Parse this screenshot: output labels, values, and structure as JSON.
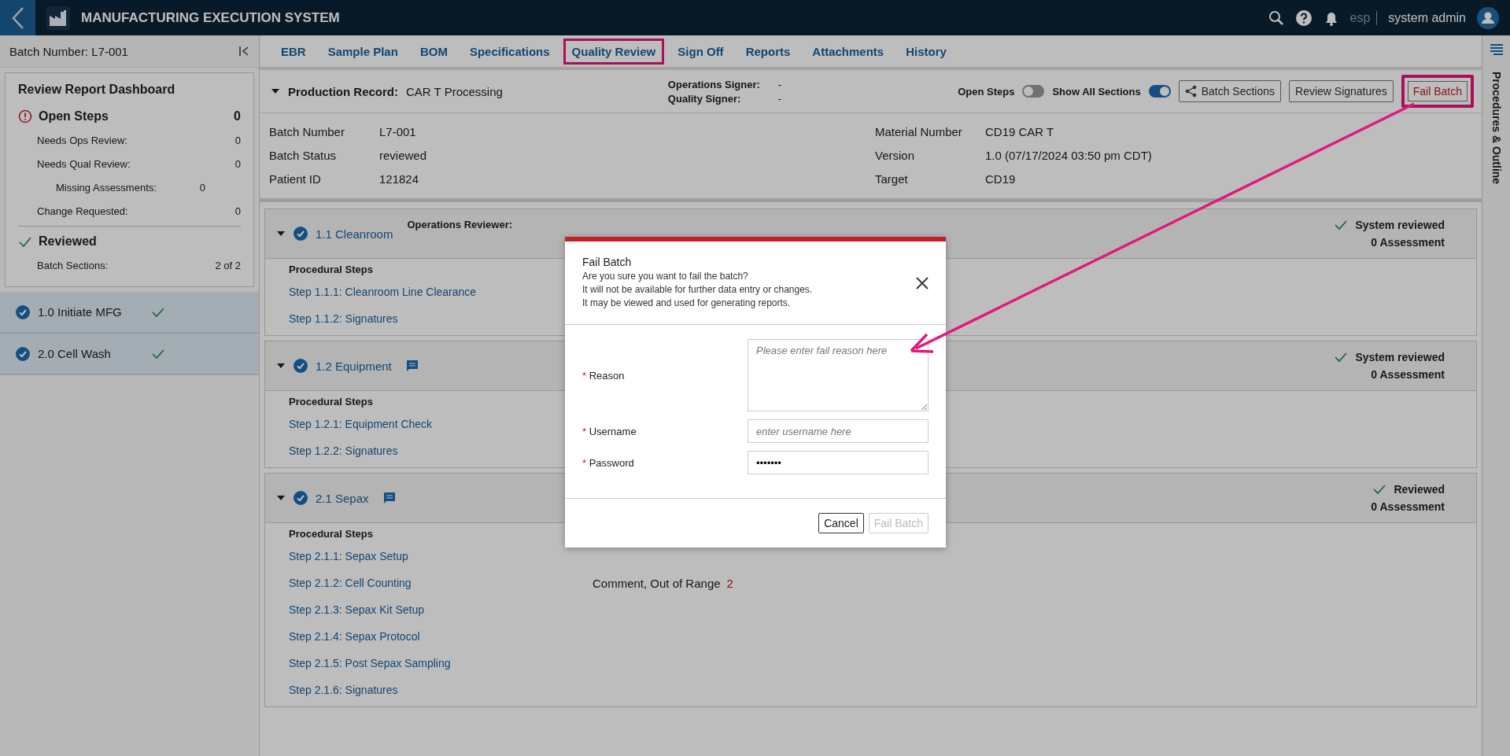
{
  "app_bar": {
    "title": "MANUFACTURING EXECUTION SYSTEM",
    "language": "esp",
    "user": "system admin"
  },
  "sidebar": {
    "batch_title": "Batch Number: L7-001",
    "dashboard": {
      "title": "Review Report Dashboard",
      "open_label": "Open Steps",
      "open_count": "0",
      "open_rows": [
        {
          "label": "Needs Ops Review:",
          "value": "0"
        },
        {
          "label": "Needs Qual Review:",
          "value": "0",
          "children": [
            {
              "label": "Missing Assessments:",
              "value": "0"
            }
          ]
        },
        {
          "label": "Change Requested:",
          "value": "0"
        }
      ],
      "reviewed_label": "Reviewed",
      "reviewed_rows": [
        {
          "label": "Batch Sections:",
          "value": "2 of 2"
        }
      ]
    },
    "sections": [
      {
        "label": "1.0 Initiate MFG",
        "done": true
      },
      {
        "label": "2.0 Cell Wash",
        "done": true
      }
    ]
  },
  "tabs": [
    {
      "label": "EBR",
      "highlighted": false
    },
    {
      "label": "Sample Plan",
      "highlighted": false
    },
    {
      "label": "BOM",
      "highlighted": false
    },
    {
      "label": "Specifications",
      "highlighted": false
    },
    {
      "label": "Quality Review",
      "highlighted": true
    },
    {
      "label": "Sign Off",
      "highlighted": false
    },
    {
      "label": "Reports",
      "highlighted": false
    },
    {
      "label": "Attachments",
      "highlighted": false
    },
    {
      "label": "History",
      "highlighted": false
    }
  ],
  "record": {
    "label": "Production Record:",
    "value": "CAR T Processing",
    "signers": [
      {
        "label": "Operations Signer:",
        "value": "-"
      },
      {
        "label": "Quality Signer:",
        "value": "-"
      }
    ],
    "toggles": [
      {
        "label": "Open Steps",
        "on": false
      },
      {
        "label": "Show All Sections",
        "on": true
      }
    ],
    "buttons": [
      {
        "label": "Batch Sections",
        "kind": "share",
        "highlighted": false
      },
      {
        "label": "Review Signatures",
        "kind": "plain",
        "highlighted": false
      },
      {
        "label": "Fail Batch",
        "kind": "danger",
        "highlighted": true
      }
    ]
  },
  "info": {
    "left": [
      {
        "label": "Batch Number",
        "value": "L7-001"
      },
      {
        "label": "Batch Status",
        "value": "reviewed"
      },
      {
        "label": "Patient ID",
        "value": "121824"
      }
    ],
    "right": [
      {
        "label": "Material Number",
        "value": "CD19 CAR T"
      },
      {
        "label": "Version",
        "value": "1.0 (07/17/2024 03:50 pm CDT)"
      },
      {
        "label": "Target",
        "value": "CD19"
      }
    ]
  },
  "sections": [
    {
      "title": "1.1 Cleanroom",
      "comment": false,
      "reviewer": "Operations Reviewer:",
      "status": "System reviewed",
      "assessment": "0 Assessment",
      "steps_heading": "Procedural Steps",
      "steps": [
        {
          "label": "Step 1.1.1: Cleanroom Line Clearance"
        },
        {
          "label": "Step 1.1.2: Signatures"
        }
      ]
    },
    {
      "title": "1.2 Equipment",
      "comment": true,
      "status": "System reviewed",
      "assessment": "0 Assessment",
      "steps_heading": "Procedural Steps",
      "steps": [
        {
          "label": "Step 1.2.1: Equipment Check"
        },
        {
          "label": "Step 1.2.2: Signatures"
        }
      ]
    },
    {
      "title": "2.1 Sepax",
      "comment": true,
      "status": "Reviewed",
      "assessment": "0 Assessment",
      "steps_heading": "Procedural Steps",
      "steps": [
        {
          "label": "Step 2.1.1: Sepax Setup"
        },
        {
          "label": "Step 2.1.2: Cell Counting",
          "note": "Comment, Out of Range",
          "note_count": "2"
        },
        {
          "label": "Step 2.1.3: Sepax Kit Setup"
        },
        {
          "label": "Step 2.1.4: Sepax Protocol"
        },
        {
          "label": "Step 2.1.5: Post Sepax Sampling"
        },
        {
          "label": "Step 2.1.6: Signatures"
        }
      ]
    }
  ],
  "side_tab": "Procedures & Outline",
  "modal": {
    "title": "Fail Batch",
    "message_lines": [
      "Are you sure you want to fail the batch?",
      "It will not be available for further data entry or changes.",
      "It may be viewed and used for generating reports."
    ],
    "fields": [
      {
        "label": "Reason",
        "required_mark": "*",
        "kind": "textarea",
        "placeholder": "Please enter fail reason here"
      },
      {
        "label": "Username",
        "required_mark": "*",
        "kind": "text",
        "placeholder": "enter username here"
      },
      {
        "label": "Password",
        "required_mark": "*",
        "kind": "text",
        "value": "•••••••"
      }
    ],
    "buttons": [
      {
        "label": "Cancel",
        "disabled": false
      },
      {
        "label": "Fail Batch",
        "disabled": true
      }
    ]
  }
}
